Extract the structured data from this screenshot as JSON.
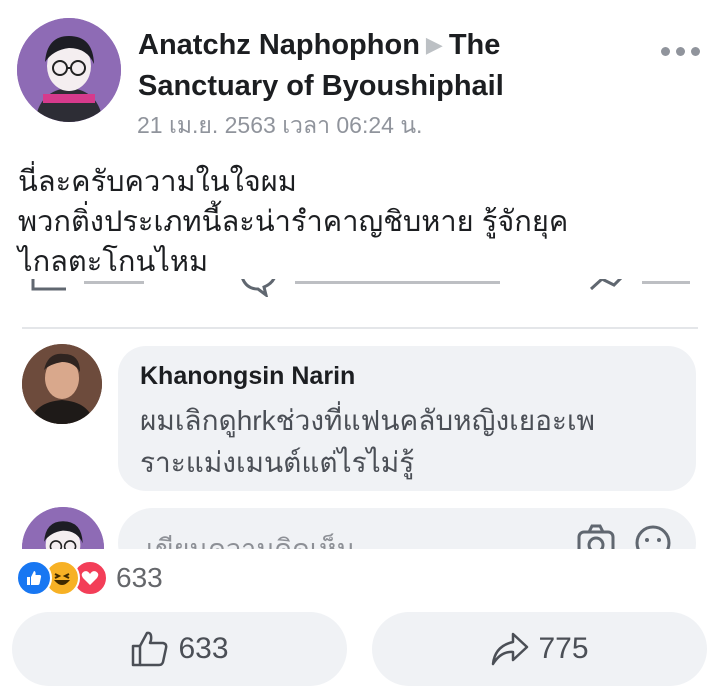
{
  "post": {
    "author": "Anatchz Naphophon",
    "group": "The Sanctuary of Byoushiphail",
    "author_line_1": "Anatchz Naphophon",
    "author_line_2": "Sanctuary of Byoushiphail",
    "group_first_word": "The",
    "timestamp": "21 เม.ย. 2563 เวลา 06:24 น.",
    "text_lines": [
      "นี่ละครับความในใจผม",
      "พวกติ่งประเภทนี้ละน่ารำคาญชิบหาย รู้จักยุค",
      "ไกลตะโกนไหม"
    ]
  },
  "screenshot": {
    "comment": {
      "name": "Khanongsin Narin",
      "text_lines": [
        "ผมเลิกดูhrkช่วงที่แฟนคลับหญิงเยอะเพ",
        "ราะแม่งเมนต์แต่ไรไม่รู้"
      ]
    },
    "input_placeholder": "เขียนความคิดเห็น"
  },
  "reactions": {
    "types": [
      "like-icon",
      "haha-icon",
      "love-icon"
    ],
    "count": "633"
  },
  "actions": {
    "like_count": "633",
    "share_count": "775"
  },
  "colors": {
    "accent": "#1877f2",
    "button_bg": "#f0f2f5",
    "secondary_text": "#90949c"
  }
}
